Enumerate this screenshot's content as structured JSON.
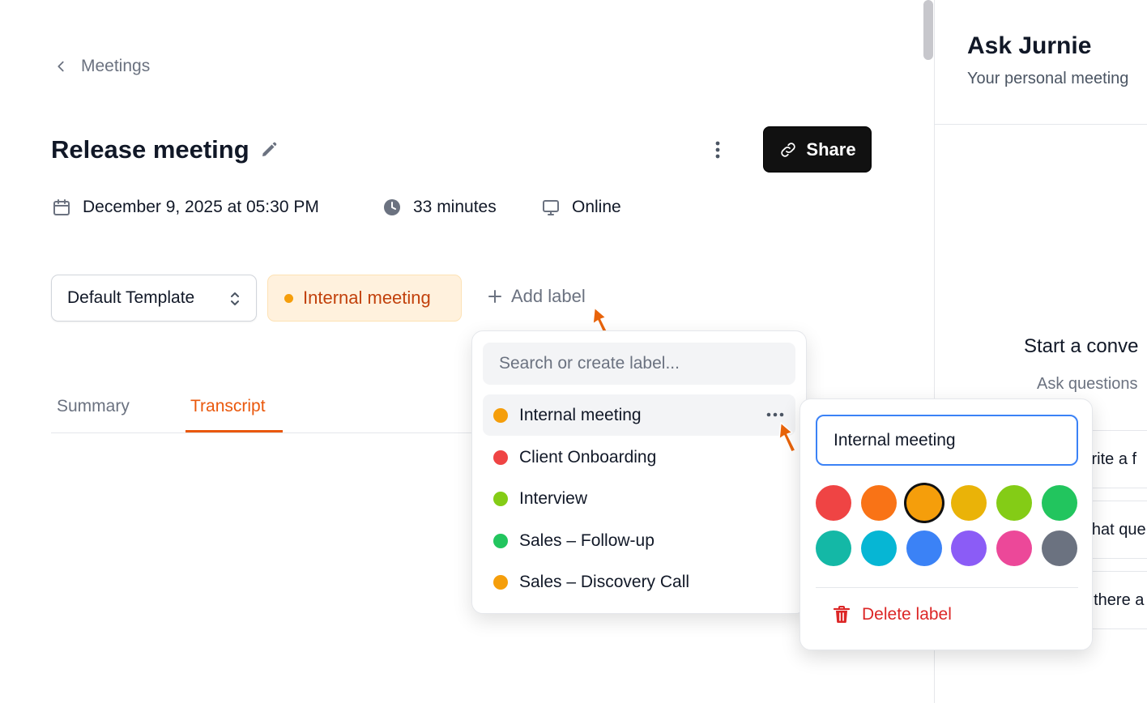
{
  "breadcrumb": {
    "back_label": "Meetings"
  },
  "meeting": {
    "title": "Release meeting",
    "date": "December 9, 2025 at 05:30 PM",
    "duration": "33 minutes",
    "location": "Online"
  },
  "toolbar": {
    "share_label": "Share"
  },
  "template": {
    "selected": "Default Template"
  },
  "labels": {
    "current": {
      "name": "Internal meeting",
      "color": "#f59e0b"
    },
    "add_label": "Add label"
  },
  "tabs": [
    {
      "label": "Summary",
      "active": false
    },
    {
      "label": "Transcript",
      "active": true
    }
  ],
  "label_dropdown": {
    "search_placeholder": "Search or create label...",
    "items": [
      {
        "name": "Internal meeting",
        "color": "#f59e0b",
        "active": true
      },
      {
        "name": "Client Onboarding",
        "color": "#ef4444",
        "active": false
      },
      {
        "name": "Interview",
        "color": "#84cc16",
        "active": false
      },
      {
        "name": "Sales – Follow-up",
        "color": "#22c55e",
        "active": false
      },
      {
        "name": "Sales – Discovery Call",
        "color": "#f59e0b",
        "active": false
      }
    ]
  },
  "label_editor": {
    "name_value": "Internal meeting",
    "colors": [
      "#ef4444",
      "#f97316",
      "#f59e0b",
      "#eab308",
      "#84cc16",
      "#22c55e",
      "#14b8a6",
      "#06b6d4",
      "#3b82f6",
      "#8b5cf6",
      "#ec4899",
      "#6b7280"
    ],
    "selected_color": "#f59e0b",
    "delete_label": "Delete label"
  },
  "ask_panel": {
    "title": "Ask Jurnie",
    "subtitle": "Your personal meeting",
    "start_heading": "Start a conve",
    "ask_text": "Ask questions",
    "suggestions": [
      "Write a f",
      "What que",
      "Is there a"
    ]
  },
  "colors": {
    "accent": "#ea580c",
    "danger": "#dc2626",
    "focus": "#3b82f6"
  }
}
